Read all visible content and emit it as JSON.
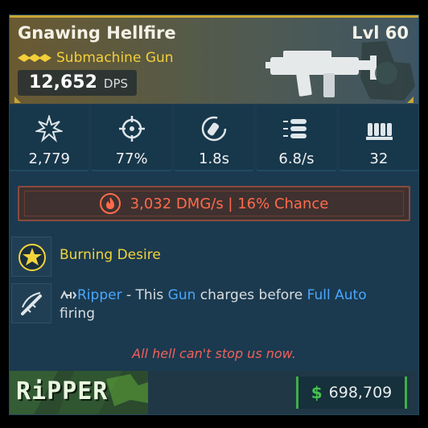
{
  "item": {
    "name": "Gnawing Hellfire",
    "level": "Lvl 60",
    "type": "Submachine Gun",
    "dps_value": "12,652",
    "dps_unit": "DPS",
    "rarity_color": "#f3cf3a"
  },
  "stats": [
    {
      "icon": "damage-burst-icon",
      "value": "2,779"
    },
    {
      "icon": "crosshair-accuracy-icon",
      "value": "77%"
    },
    {
      "icon": "reload-time-icon",
      "value": "1.8s"
    },
    {
      "icon": "fire-rate-icon",
      "value": "6.8/s"
    },
    {
      "icon": "magazine-icon",
      "value": "32"
    }
  ],
  "elemental": {
    "icon": "fire-element-icon",
    "text": "3,032 DMG/s | 16% Chance",
    "color": "#ff6b4a"
  },
  "perks": {
    "perk1_icon": "star-badge-icon",
    "perk1_title": "Burning Desire",
    "perk2_icon": "blade-slash-icon",
    "perk2_part1": "Ripper",
    "perk2_part2": " - This ",
    "perk2_part3": "Gun",
    "perk2_part4": " charges before ",
    "perk2_part5": "Full Auto",
    "perk2_part6": " firing"
  },
  "flavor_text": "All hell can't stop us now.",
  "footer": {
    "manufacturer": "RiPPER",
    "price_symbol": "$",
    "price": "698,709"
  }
}
